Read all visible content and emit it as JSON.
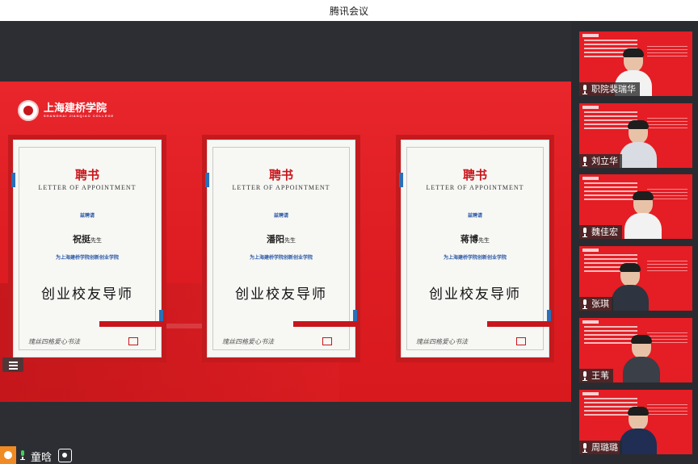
{
  "app": {
    "title": "腾讯会议"
  },
  "share_screen": {
    "school_logo": {
      "name": "上海建桥学院",
      "sub": "SHANGHAI JIANQIAO COLLEGE"
    },
    "certificates": [
      {
        "header": "聘书",
        "header_en": "LETTER OF APPOINTMENT",
        "invite": "兹聘请",
        "name": "祝挺",
        "honorific": "先生",
        "org": "为上海建桥学院创新创业学院",
        "role": "创业校友导师",
        "slogan": "瑰丝四格爱心书法"
      },
      {
        "header": "聘书",
        "header_en": "LETTER OF APPOINTMENT",
        "invite": "兹聘请",
        "name": "潘阳",
        "honorific": "先生",
        "org": "为上海建桥学院创新创业学院",
        "role": "创业校友导师",
        "slogan": "瑰丝四格爱心书法"
      },
      {
        "header": "聘书",
        "header_en": "LETTER OF APPOINTMENT",
        "invite": "兹聘请",
        "name": "蒋博",
        "honorific": "先生",
        "org": "为上海建桥学院创新创业学院",
        "role": "创业校友导师",
        "slogan": "瑰丝四格爱心书法"
      }
    ]
  },
  "participants": [
    {
      "name": "职院裴瑞华",
      "hair_color": "#1e1e1e",
      "shirt_color": "#f2f2f2",
      "person_offset": "right"
    },
    {
      "name": "刘立华",
      "hair_color": "#1e1e1e",
      "shirt_color": "#d9dde3",
      "person_offset": "right"
    },
    {
      "name": "魏佳宏",
      "hair_color": "#1e1e1e",
      "shirt_color": "#f2f2f2",
      "person_offset": "right"
    },
    {
      "name": "张琪",
      "hair_color": "#1e1e1e",
      "shirt_color": "#2e3440",
      "person_offset": "center"
    },
    {
      "name": "王苇",
      "hair_color": "#1e1e1e",
      "shirt_color": "#3a3f48",
      "person_offset": "right"
    },
    {
      "name": "周璐璐",
      "hair_color": "#1e1e1e",
      "shirt_color": "#1f2e52",
      "person_offset": "right"
    }
  ],
  "self_bar": {
    "name": "童晗"
  }
}
